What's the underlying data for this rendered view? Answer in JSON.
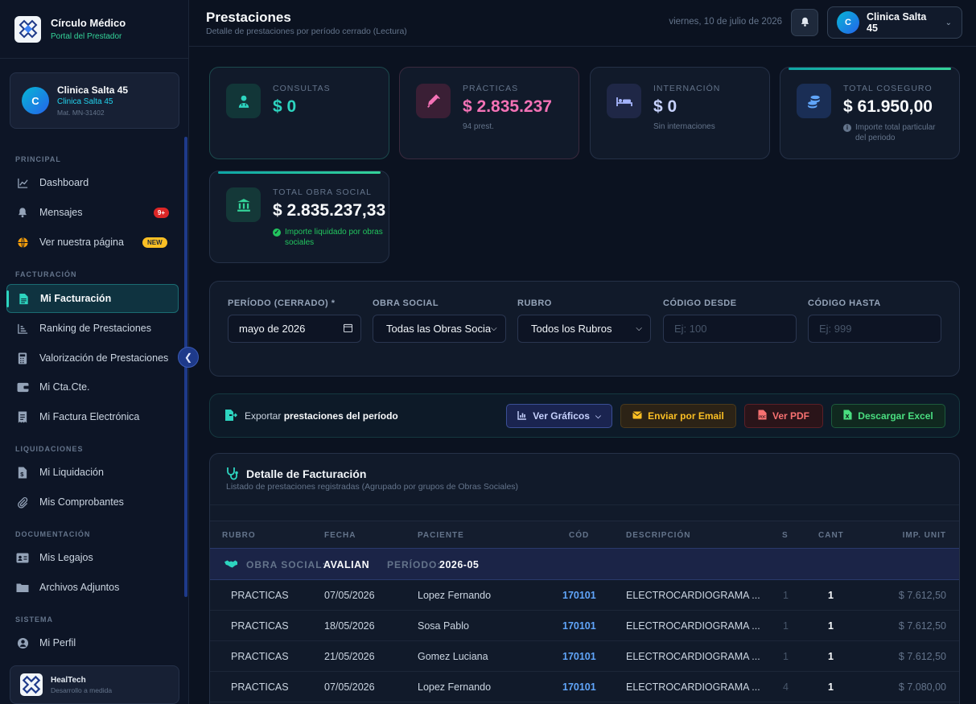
{
  "brand": {
    "title": "Círculo Médico",
    "subtitle": "Portal del Prestador"
  },
  "user_card": {
    "initial": "C",
    "name": "Clinica Salta 45",
    "sub": "Clinica Salta 45",
    "mat": "Mat. MN-31402"
  },
  "nav": {
    "sections": [
      "PRINCIPAL",
      "FACTURACIÓN",
      "LIQUIDACIONES",
      "DOCUMENTACIÓN",
      "SISTEMA"
    ],
    "items": [
      {
        "label": "Dashboard",
        "icon": "chart-line-icon"
      },
      {
        "label": "Mensajes",
        "icon": "bell-icon",
        "badge": "9+"
      },
      {
        "label": "Ver nuestra página",
        "icon": "globe-icon",
        "badge": "NEW"
      },
      {
        "label": "Mi Facturación",
        "icon": "invoice-icon",
        "active": true
      },
      {
        "label": "Ranking de Prestaciones",
        "icon": "ranking-icon"
      },
      {
        "label": "Valorización de Prestaciones",
        "icon": "calculator-icon"
      },
      {
        "label": "Mi Cta.Cte.",
        "icon": "wallet-icon"
      },
      {
        "label": "Mi Factura Electrónica",
        "icon": "receipt-icon"
      },
      {
        "label": "Mi Liquidación",
        "icon": "file-dollar-icon"
      },
      {
        "label": "Mis Comprobantes",
        "icon": "paperclip-icon"
      },
      {
        "label": "Mis Legajos",
        "icon": "id-card-icon"
      },
      {
        "label": "Archivos Adjuntos",
        "icon": "folder-icon"
      },
      {
        "label": "Mi Perfil",
        "icon": "user-circle-icon"
      }
    ]
  },
  "footer": {
    "title": "HealTech",
    "subtitle": "Desarrollo a medida"
  },
  "header": {
    "title": "Prestaciones",
    "subtitle": "Detalle de prestaciones por período cerrado (Lectura)",
    "date": "viernes, 10 de julio de 2026",
    "user_initial": "C",
    "user_name": "Clinica Salta 45"
  },
  "stats": {
    "consultas": {
      "label": "CONSULTAS",
      "value": "$ 0"
    },
    "practicas": {
      "label": "PRÁCTICAS",
      "value": "$ 2.835.237",
      "note": "94 prest."
    },
    "internacion": {
      "label": "INTERNACIÓN",
      "value": "$ 0",
      "note": "Sin internaciones"
    },
    "coseguro": {
      "label": "TOTAL COSEGURO",
      "value": "$ 61.950,00",
      "note": "Importe total particular del periodo"
    },
    "obra_social": {
      "label": "TOTAL OBRA SOCIAL",
      "value": "$ 2.835.237,33",
      "note": "Importe liquidado por obras sociales"
    }
  },
  "filters": {
    "periodo": {
      "label": "PERÍODO (CERRADO) *",
      "value": "mayo de 2026"
    },
    "obra_social": {
      "label": "OBRA SOCIAL",
      "value": "Todas las Obras Sociales"
    },
    "rubro": {
      "label": "RUBRO",
      "value": "Todos los Rubros"
    },
    "codigo_desde": {
      "label": "CÓDIGO DESDE",
      "placeholder": "Ej: 100"
    },
    "codigo_hasta": {
      "label": "CÓDIGO HASTA",
      "placeholder": "Ej: 999"
    }
  },
  "export": {
    "prefix": "Exportar",
    "bold": "prestaciones del período",
    "graficos": "Ver Gráficos",
    "email": "Enviar por Email",
    "pdf": "Ver PDF",
    "excel": "Descargar Excel"
  },
  "table": {
    "title": "Detalle de Facturación",
    "subtitle": "Listado de prestaciones registradas (Agrupado por grupos de Obras Sociales)",
    "headers": [
      "RUBRO",
      "FECHA",
      "PACIENTE",
      "CÓD",
      "DESCRIPCIÓN",
      "S",
      "CANT",
      "IMP. UNIT"
    ],
    "group": {
      "os_label": "OBRA SOCIAL:",
      "os_value": "AVALIAN",
      "period_label": "PERÍODO:",
      "period_value": "2026-05"
    },
    "rows": [
      [
        "PRACTICAS",
        "07/05/2026",
        "Lopez Fernando",
        "170101",
        "ELECTROCARDIOGRAMA ...",
        "1",
        "1",
        "$ 7.612,50"
      ],
      [
        "PRACTICAS",
        "18/05/2026",
        "Sosa Pablo",
        "170101",
        "ELECTROCARDIOGRAMA ...",
        "1",
        "1",
        "$ 7.612,50"
      ],
      [
        "PRACTICAS",
        "21/05/2026",
        "Gomez Luciana",
        "170101",
        "ELECTROCARDIOGRAMA ...",
        "1",
        "1",
        "$ 7.612,50"
      ],
      [
        "PRACTICAS",
        "07/05/2026",
        "Lopez Fernando",
        "170101",
        "ELECTROCARDIOGRAMA ...",
        "4",
        "1",
        "$ 7.080,00"
      ]
    ]
  },
  "colors": {
    "accent": "#2dd4bf",
    "pink": "#f472b6",
    "link": "#60a5fa",
    "green": "#22c55e"
  }
}
